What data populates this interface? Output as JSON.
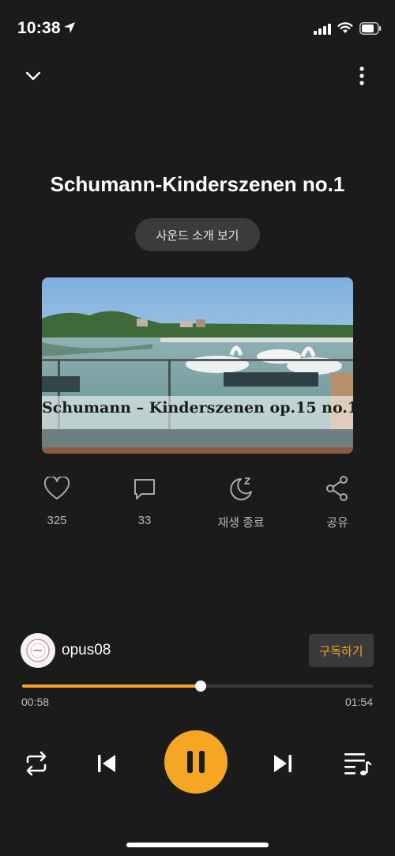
{
  "status_bar": {
    "time": "10:38"
  },
  "track": {
    "title": "Schumann-Kinderszenen no.1"
  },
  "intro_button": {
    "label": "사운드 소개 보기"
  },
  "cover": {
    "caption": "Schumann – Kinderszenen op.15 no.1"
  },
  "actions": [
    {
      "icon": "heart-icon",
      "label": "325"
    },
    {
      "icon": "comment-icon",
      "label": "33"
    },
    {
      "icon": "sleep-timer-moon-icon",
      "label": "재생 종료"
    },
    {
      "icon": "share-icon",
      "label": "공유"
    }
  ],
  "uploader": {
    "name": "opus08",
    "subscribe_label": "구독하기"
  },
  "playback": {
    "current": "00:58",
    "total": "01:54",
    "progress_fraction": 0.509
  },
  "colors": {
    "accent": "#f5a623",
    "background": "#1b1b1b",
    "button_dark": "#3a3a3a"
  }
}
